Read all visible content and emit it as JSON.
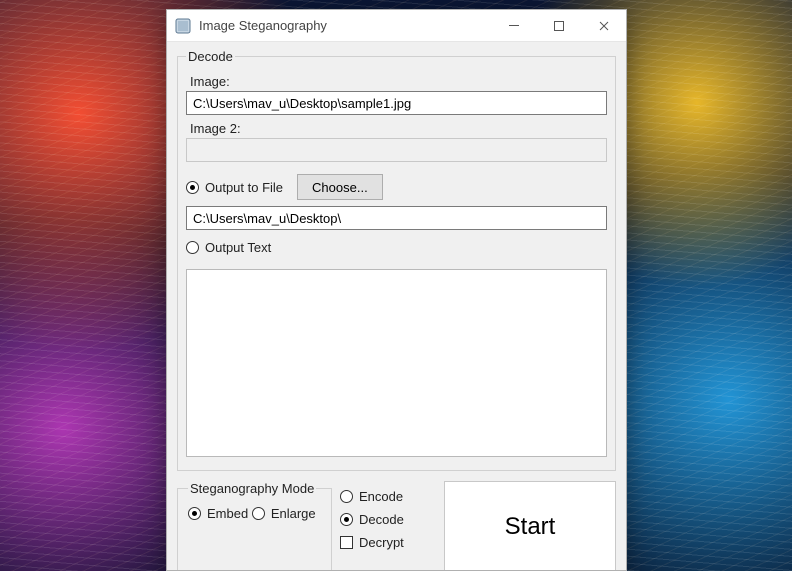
{
  "window": {
    "title": "Image Steganography"
  },
  "decode_group": {
    "legend": "Decode",
    "image_label": "Image:",
    "image_value": "C:\\Users\\mav_u\\Desktop\\sample1.jpg",
    "image2_label": "Image 2:",
    "image2_value": "",
    "output_file_label": "Output to File",
    "choose_label": "Choose...",
    "output_path_value": "C:\\Users\\mav_u\\Desktop\\",
    "output_text_label": "Output Text",
    "output_text_value": "",
    "output_radio_selected": "file"
  },
  "mode_group": {
    "legend": "Steganography Mode",
    "options": [
      {
        "label": "Embed",
        "selected": true
      },
      {
        "label": "Enlarge",
        "selected": false
      }
    ]
  },
  "right_opts": {
    "encode_label": "Encode",
    "decode_label": "Decode",
    "decrypt_label": "Decrypt",
    "selected": "decode",
    "decrypt_checked": false
  },
  "start": {
    "label": "Start"
  }
}
